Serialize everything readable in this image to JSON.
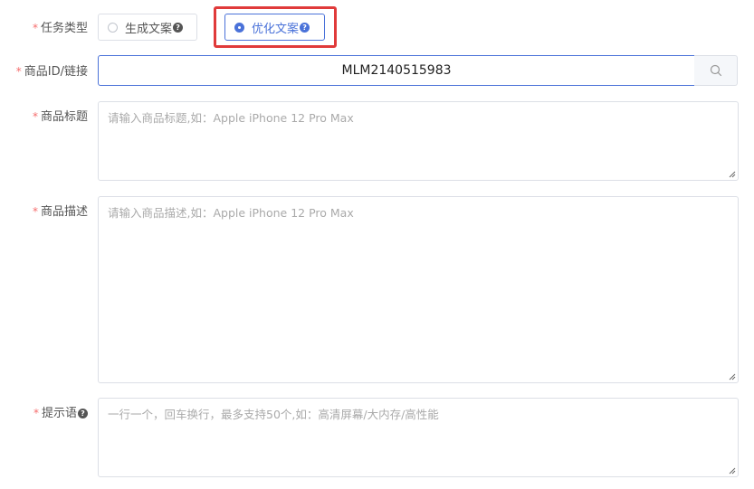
{
  "task_type": {
    "label": "任务类型",
    "options": [
      {
        "label": "生成文案",
        "selected": false
      },
      {
        "label": "优化文案",
        "selected": true
      }
    ]
  },
  "product_id": {
    "label": "商品ID/链接",
    "value": "MLM2140515983"
  },
  "product_title": {
    "label": "商品标题",
    "placeholder": "请输入商品标题,如：Apple iPhone 12 Pro Max"
  },
  "product_desc": {
    "label": "商品描述",
    "placeholder": "请输入商品描述,如：Apple iPhone 12 Pro Max"
  },
  "prompt": {
    "label": "提示语",
    "placeholder": "一行一个，回车换行，最多支持50个,如：高清屏幕/大内存/高性能"
  },
  "colors": {
    "accent": "#4a72d9",
    "required": "#f56c6c",
    "highlight": "#e03a3a"
  }
}
